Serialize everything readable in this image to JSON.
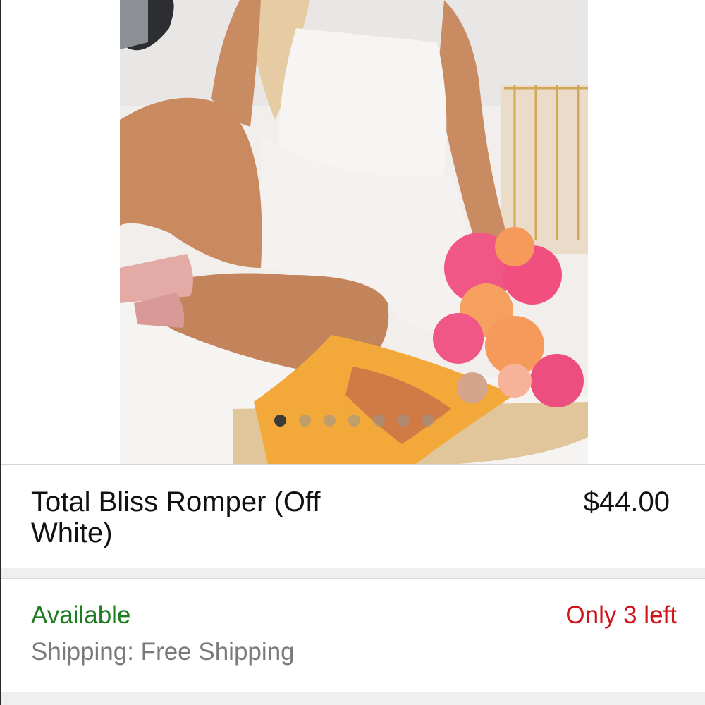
{
  "product": {
    "title": "Total Bliss Romper (Off White)",
    "price": "$44.00",
    "image": {
      "description_icon": "product-photo",
      "slide_count": 7,
      "active_slide": 1
    }
  },
  "availability": {
    "status": "Available",
    "stock": "Only 3 left",
    "shipping": "Shipping: Free Shipping"
  },
  "colors": {
    "available": "#1e7d22",
    "stock_warning": "#d0141c",
    "shipping_text": "#7a7a7a"
  }
}
